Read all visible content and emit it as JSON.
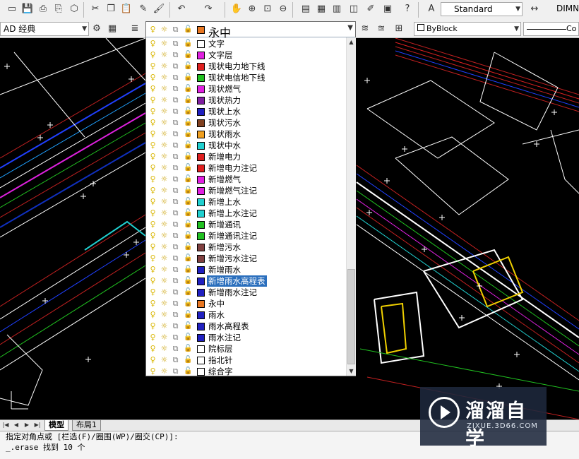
{
  "toolbar_top": {
    "icons": [
      "new-icon",
      "save-icon",
      "print-preview-icon",
      "plot-icon",
      "publish-icon",
      "cut-icon",
      "copy-icon",
      "paste-icon",
      "match-properties-icon",
      "brush-icon",
      "undo-icon",
      "redo-icon",
      "pan-icon",
      "zoom-realtime-icon",
      "zoom-window-icon",
      "zoom-previous-icon",
      "properties-icon",
      "design-center-icon",
      "tool-palette-icon",
      "sheet-set-icon",
      "markup-icon",
      "calculator-icon",
      "help-icon",
      "text-style-icon",
      "dim-style-icon"
    ],
    "text_style": "Standard",
    "dim_style": "DIMN"
  },
  "toolbar_layers": {
    "workspace": "AD 经典",
    "current_layer_name": "永中",
    "current_layer_color": "#e87722",
    "color_control": "ByBlock",
    "linetype_control": "Co"
  },
  "layers": [
    {
      "name": "文字",
      "color": "#ffffff"
    },
    {
      "name": "文字层",
      "color": "#e020e0"
    },
    {
      "name": "现状电力地下线",
      "color": "#e02020"
    },
    {
      "name": "现状电信地下线",
      "color": "#20c020"
    },
    {
      "name": "现状燃气",
      "color": "#e020e0"
    },
    {
      "name": "现状热力",
      "color": "#8020a0"
    },
    {
      "name": "现状上水",
      "color": "#2020c0"
    },
    {
      "name": "现状污水",
      "color": "#804020"
    },
    {
      "name": "现状雨水",
      "color": "#f0a020"
    },
    {
      "name": "现状中水",
      "color": "#20d0d0"
    },
    {
      "name": "新增电力",
      "color": "#e02020"
    },
    {
      "name": "新增电力注记",
      "color": "#e02020"
    },
    {
      "name": "新增燃气",
      "color": "#e020e0"
    },
    {
      "name": "新增燃气注记",
      "color": "#e020e0"
    },
    {
      "name": "新增上水",
      "color": "#20d0d0"
    },
    {
      "name": "新增上水注记",
      "color": "#20d0d0"
    },
    {
      "name": "新增通讯",
      "color": "#20c020"
    },
    {
      "name": "新增通讯注记",
      "color": "#20c020"
    },
    {
      "name": "新增污水",
      "color": "#804040"
    },
    {
      "name": "新增污水注记",
      "color": "#804040"
    },
    {
      "name": "新增雨水",
      "color": "#2020c0"
    },
    {
      "name": "新增雨水高程表",
      "color": "#2020c0",
      "selected": true
    },
    {
      "name": "新增雨水注记",
      "color": "#2020c0"
    },
    {
      "name": "永中",
      "color": "#e87722"
    },
    {
      "name": "雨水",
      "color": "#2020c0"
    },
    {
      "name": "雨水高程表",
      "color": "#2020c0"
    },
    {
      "name": "雨水注记",
      "color": "#2020c0"
    },
    {
      "name": "院标层",
      "color": "#ffffff"
    },
    {
      "name": "指北针",
      "color": "#ffffff"
    },
    {
      "name": "综合字",
      "color": "#ffffff"
    }
  ],
  "tabs": {
    "model": "模型",
    "layout1": "布局1"
  },
  "command_line": {
    "line1": "指定对角点或 [栏选(F)/圈围(WP)/圈交(CP)]:",
    "line2": "_.erase 找到 10 个"
  },
  "watermark": {
    "name": "溜溜自学",
    "url": "ZIXUE.3D66.COM"
  },
  "colors": {
    "selection": "#2b6fbd",
    "canvas": "#000000",
    "toolbar": "#f0f0f0"
  }
}
